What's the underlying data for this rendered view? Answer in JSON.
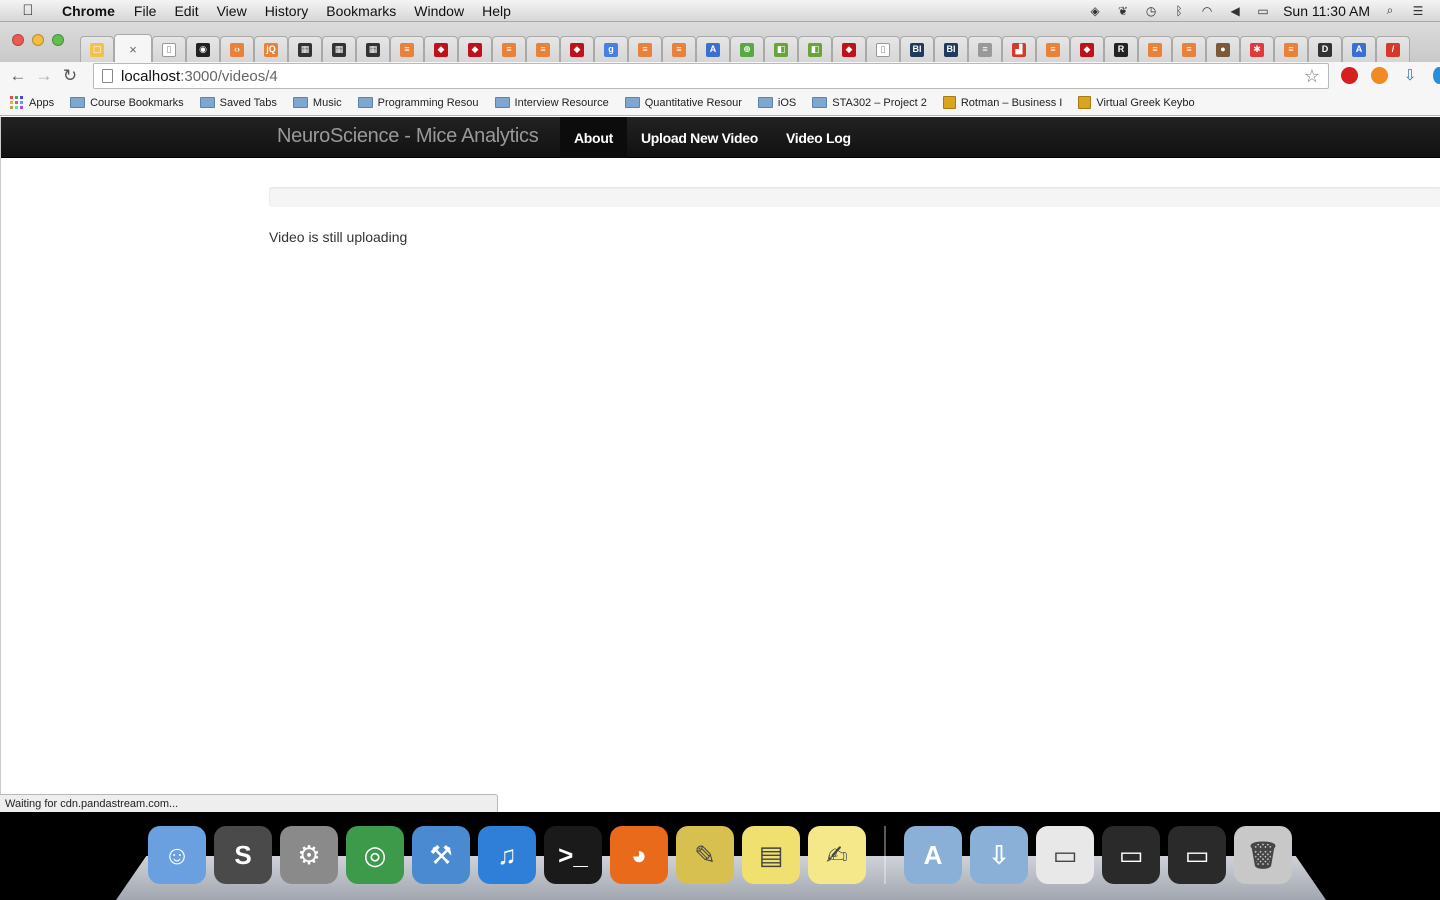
{
  "menubar": {
    "app_name": "Chrome",
    "items": [
      "File",
      "Edit",
      "View",
      "History",
      "Bookmarks",
      "Window",
      "Help"
    ],
    "clock": "Sun 11:30 AM"
  },
  "tabs": [
    {
      "icon": "generic-yellow-icon",
      "color": "#f2c14e",
      "glyph": "▢"
    },
    {
      "icon": "close-icon",
      "active": true,
      "glyph": "×"
    },
    {
      "icon": "page-icon",
      "color": "#ffffff",
      "glyph": "▯"
    },
    {
      "icon": "github-icon",
      "color": "#222222",
      "glyph": "◉"
    },
    {
      "icon": "code-icon",
      "color": "#e8813a",
      "glyph": "‹›"
    },
    {
      "icon": "jquery-icon",
      "color": "#e8813a",
      "glyph": "jQ"
    },
    {
      "icon": "grid-icon",
      "color": "#333333",
      "glyph": "▦"
    },
    {
      "icon": "grid-icon",
      "color": "#333333",
      "glyph": "▦"
    },
    {
      "icon": "grid-icon",
      "color": "#333333",
      "glyph": "▦"
    },
    {
      "icon": "stackoverflow-icon",
      "color": "#e8813a",
      "glyph": "≡"
    },
    {
      "icon": "rails-icon",
      "color": "#c0101a",
      "glyph": "◆"
    },
    {
      "icon": "rails-icon",
      "color": "#c0101a",
      "glyph": "◆"
    },
    {
      "icon": "stackoverflow-icon",
      "color": "#e8813a",
      "glyph": "≡"
    },
    {
      "icon": "stackoverflow-icon",
      "color": "#e8813a",
      "glyph": "≡"
    },
    {
      "icon": "rails-icon",
      "color": "#c0101a",
      "glyph": "◆"
    },
    {
      "icon": "google-icon",
      "color": "#4a7fe0",
      "glyph": "g"
    },
    {
      "icon": "stackoverflow-icon",
      "color": "#e8813a",
      "glyph": "≡"
    },
    {
      "icon": "stackoverflow-icon",
      "color": "#e8813a",
      "glyph": "≡"
    },
    {
      "icon": "letter-a-icon",
      "color": "#3d6fd1",
      "glyph": "A"
    },
    {
      "icon": "green-icon",
      "color": "#5aa845",
      "glyph": "⊕"
    },
    {
      "icon": "shopify-icon",
      "color": "#6aa33a",
      "glyph": "◧"
    },
    {
      "icon": "shopify-icon",
      "color": "#6aa33a",
      "glyph": "◧"
    },
    {
      "icon": "rails-icon",
      "color": "#c0101a",
      "glyph": "◆"
    },
    {
      "icon": "page-icon",
      "color": "#ffffff",
      "glyph": "▯"
    },
    {
      "icon": "bi-icon",
      "color": "#1f3a5a",
      "glyph": "BI"
    },
    {
      "icon": "bi-icon",
      "color": "#1f3a5a",
      "glyph": "BI"
    },
    {
      "icon": "stackoverflow-icon",
      "color": "#999999",
      "glyph": "≡"
    },
    {
      "icon": "chart-icon",
      "color": "#d33a2c",
      "glyph": "▟"
    },
    {
      "icon": "stackoverflow-icon",
      "color": "#e8813a",
      "glyph": "≡"
    },
    {
      "icon": "rails-icon",
      "color": "#c0101a",
      "glyph": "◆"
    },
    {
      "icon": "r-icon",
      "color": "#222222",
      "glyph": "R"
    },
    {
      "icon": "stackoverflow-icon",
      "color": "#e8813a",
      "glyph": "≡"
    },
    {
      "icon": "stackoverflow-icon",
      "color": "#e8813a",
      "glyph": "≡"
    },
    {
      "icon": "avatar-icon",
      "color": "#7a5a3a",
      "glyph": "●"
    },
    {
      "icon": "puzzle-icon",
      "color": "#e03a3a",
      "glyph": "✱"
    },
    {
      "icon": "stackoverflow-icon",
      "color": "#e8813a",
      "glyph": "≡"
    },
    {
      "icon": "letter-d-icon",
      "color": "#333333",
      "glyph": "D"
    },
    {
      "icon": "letter-a-icon",
      "color": "#3d6fd1",
      "glyph": "A"
    },
    {
      "icon": "slash-icon",
      "color": "#d33a2c",
      "glyph": "/"
    }
  ],
  "address": {
    "host": "localhost",
    "path": ":3000/videos/4"
  },
  "bookmarks": [
    {
      "label": "Apps",
      "kind": "apps"
    },
    {
      "label": "Course Bookmarks",
      "kind": "folder"
    },
    {
      "label": "Saved Tabs",
      "kind": "folder"
    },
    {
      "label": "Music",
      "kind": "folder"
    },
    {
      "label": "Programming Resou",
      "kind": "folder",
      "trunc": true
    },
    {
      "label": "Interview Resource",
      "kind": "folder",
      "trunc": true
    },
    {
      "label": "Quantitative Resour",
      "kind": "folder",
      "trunc": true
    },
    {
      "label": "iOS",
      "kind": "folder"
    },
    {
      "label": "STA302 – Project 2",
      "kind": "folder"
    },
    {
      "label": "Rotman – Business I",
      "kind": "site",
      "trunc": true
    },
    {
      "label": "Virtual Greek Keybo",
      "kind": "site",
      "trunc": true
    }
  ],
  "site": {
    "brand": "NeuroScience - Mice Analytics",
    "nav": [
      {
        "label": "About",
        "active": true
      },
      {
        "label": "Upload New Video",
        "active": false
      },
      {
        "label": "Video Log",
        "active": false
      }
    ],
    "upload_progress_percent": 0,
    "message": "Video is still uploading"
  },
  "status_bubble": "Waiting for cdn.pandastream.com...",
  "dock": [
    {
      "icon": "finder-icon",
      "color": "#6aa0e0",
      "glyph": "☺"
    },
    {
      "icon": "sublime-text-icon",
      "color": "#4a4a4a",
      "glyph": "S"
    },
    {
      "icon": "system-preferences-icon",
      "color": "#8a8a8a",
      "glyph": "⚙"
    },
    {
      "icon": "chrome-icon",
      "color": "#3c9a4a",
      "glyph": "◎"
    },
    {
      "icon": "xcode-icon",
      "color": "#4a8ad0",
      "glyph": "⚒"
    },
    {
      "icon": "itunes-icon",
      "color": "#2f7fd8",
      "glyph": "♫"
    },
    {
      "icon": "terminal-icon",
      "color": "#1a1a1a",
      "glyph": ">_"
    },
    {
      "icon": "firefox-icon",
      "color": "#e86a1a",
      "glyph": "◕"
    },
    {
      "icon": "paintbrush-icon",
      "color": "#d8c050",
      "glyph": "✎"
    },
    {
      "icon": "stickies-icon",
      "color": "#f0e070",
      "glyph": "▤"
    },
    {
      "icon": "notes-icon",
      "color": "#f4e88a",
      "glyph": "✍"
    },
    {
      "separator": true
    },
    {
      "icon": "applications-folder-icon",
      "color": "#8ab0d8",
      "glyph": "A"
    },
    {
      "icon": "downloads-folder-icon",
      "color": "#8ab0d8",
      "glyph": "⇩"
    },
    {
      "icon": "window-thumbnail-icon",
      "color": "#e8e8e8",
      "glyph": "▭"
    },
    {
      "icon": "window-thumbnail-icon",
      "color": "#2a2a2a",
      "glyph": "▭"
    },
    {
      "icon": "window-thumbnail-icon",
      "color": "#2a2a2a",
      "glyph": "▭"
    },
    {
      "icon": "trash-icon",
      "color": "#c8c8c8",
      "glyph": "🗑"
    }
  ]
}
